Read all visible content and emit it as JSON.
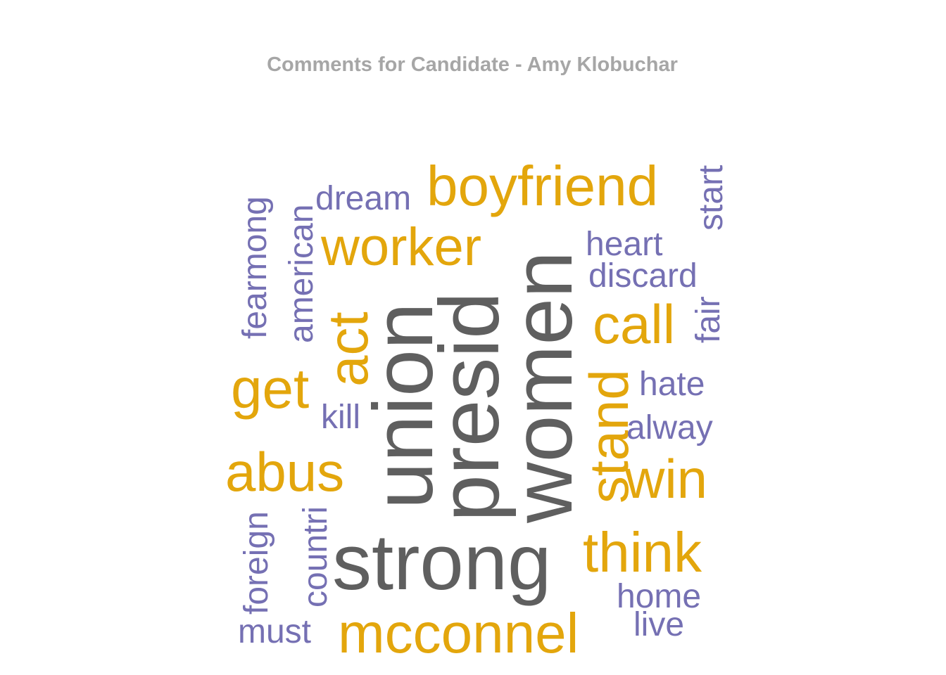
{
  "chart_data": {
    "type": "wordcloud",
    "title": "Comments for Candidate - Amy Klobuchar",
    "colors": {
      "high": "#5f5f5f",
      "mid": "#e3a60c",
      "low": "#7570b3"
    },
    "words": [
      {
        "text": "presid",
        "tier": "high"
      },
      {
        "text": "women",
        "tier": "high"
      },
      {
        "text": "strong",
        "tier": "high"
      },
      {
        "text": "union",
        "tier": "high"
      },
      {
        "text": "mcconnel",
        "tier": "mid"
      },
      {
        "text": "boyfriend",
        "tier": "mid"
      },
      {
        "text": "worker",
        "tier": "mid"
      },
      {
        "text": "think",
        "tier": "mid"
      },
      {
        "text": "abus",
        "tier": "mid"
      },
      {
        "text": "stand",
        "tier": "mid"
      },
      {
        "text": "win",
        "tier": "mid"
      },
      {
        "text": "call",
        "tier": "mid"
      },
      {
        "text": "get",
        "tier": "mid"
      },
      {
        "text": "act",
        "tier": "mid"
      },
      {
        "text": "dream",
        "tier": "low"
      },
      {
        "text": "fearmong",
        "tier": "low"
      },
      {
        "text": "american",
        "tier": "low"
      },
      {
        "text": "heart",
        "tier": "low"
      },
      {
        "text": "discard",
        "tier": "low"
      },
      {
        "text": "start",
        "tier": "low"
      },
      {
        "text": "fair",
        "tier": "low"
      },
      {
        "text": "hate",
        "tier": "low"
      },
      {
        "text": "alway",
        "tier": "low"
      },
      {
        "text": "kill",
        "tier": "low"
      },
      {
        "text": "foreign",
        "tier": "low"
      },
      {
        "text": "countri",
        "tier": "low"
      },
      {
        "text": "home",
        "tier": "low"
      },
      {
        "text": "live",
        "tier": "low"
      },
      {
        "text": "must",
        "tier": "low"
      }
    ]
  }
}
